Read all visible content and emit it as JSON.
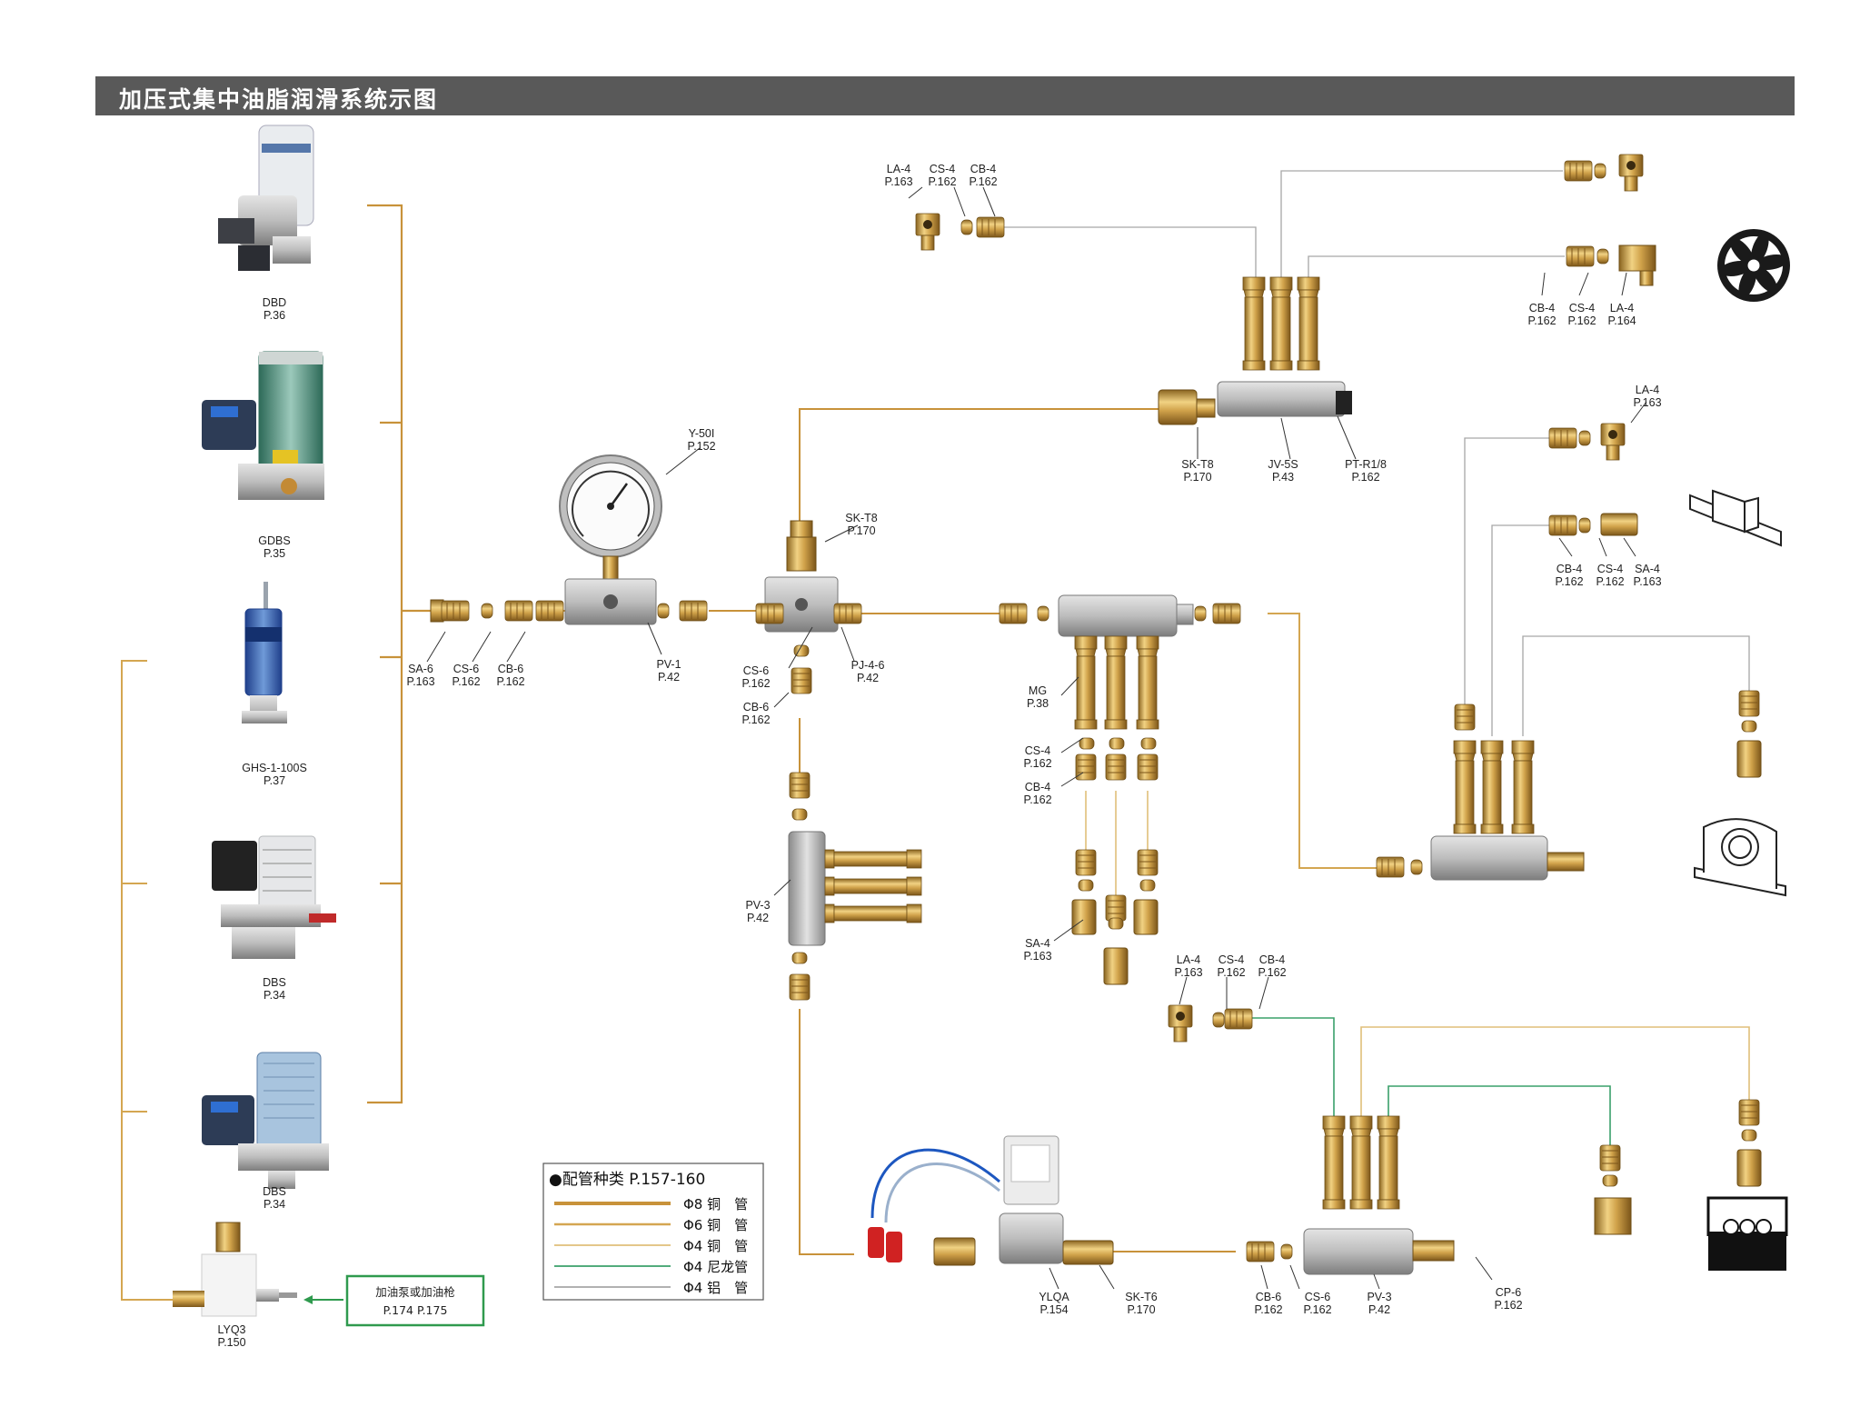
{
  "title": "加压式集中油脂润滑系统示图",
  "pumps": [
    {
      "model": "DBD",
      "page": "P.36"
    },
    {
      "model": "GDBS",
      "page": "P.35"
    },
    {
      "model": "GHS-1-100S",
      "page": "P.37"
    },
    {
      "model": "DBS",
      "page": "P.34"
    },
    {
      "model": "DBS",
      "page": "P.34"
    }
  ],
  "filler": {
    "model": "LYQ3",
    "page": "P.150"
  },
  "filler_notice": {
    "line1": "加油泵或加油枪",
    "line2": "P.174  P.175"
  },
  "gauge": {
    "model": "Y-50I",
    "page": "P.152"
  },
  "parts": {
    "sa6": {
      "model": "SA-6",
      "page": "P.163"
    },
    "cs6": {
      "model": "CS-6",
      "page": "P.162"
    },
    "cb6": {
      "model": "CB-6",
      "page": "P.162"
    },
    "pv1": {
      "model": "PV-1",
      "page": "P.42"
    },
    "skt8_mid": {
      "model": "SK-T8",
      "page": "P.170"
    },
    "pj46": {
      "model": "PJ-4-6",
      "page": "P.42"
    },
    "cs6_b": {
      "model": "CS-6",
      "page": "P.162"
    },
    "cb6_b": {
      "model": "CB-6",
      "page": "P.162"
    },
    "pv3_left": {
      "model": "PV-3",
      "page": "P.42"
    },
    "mg": {
      "model": "MG",
      "page": "P.38"
    },
    "cs4_mg": {
      "model": "CS-4",
      "page": "P.162"
    },
    "cb4_mg": {
      "model": "CB-4",
      "page": "P.162"
    },
    "sa4_mg": {
      "model": "SA-4",
      "page": "P.163"
    },
    "la4_top": {
      "model": "LA-4",
      "page": "P.163"
    },
    "cs4_top": {
      "model": "CS-4",
      "page": "P.162"
    },
    "cb4_top": {
      "model": "CB-4",
      "page": "P.162"
    },
    "skt8_top": {
      "model": "SK-T8",
      "page": "P.170"
    },
    "jv5s": {
      "model": "JV-5S",
      "page": "P.43"
    },
    "ptr18": {
      "model": "PT-R1/8",
      "page": "P.162"
    },
    "cb4_tr": {
      "model": "CB-4",
      "page": "P.162"
    },
    "cs4_tr": {
      "model": "CS-4",
      "page": "P.162"
    },
    "la4_tr": {
      "model": "LA-4",
      "page": "P.164"
    },
    "la4_r": {
      "model": "LA-4",
      "page": "P.163"
    },
    "cb4_r": {
      "model": "CB-4",
      "page": "P.162"
    },
    "cs4_r": {
      "model": "CS-4",
      "page": "P.162"
    },
    "sa4_r": {
      "model": "SA-4",
      "page": "P.163"
    },
    "la4_b": {
      "model": "LA-4",
      "page": "P.163"
    },
    "cs4_b": {
      "model": "CS-4",
      "page": "P.162"
    },
    "cb4_b": {
      "model": "CB-4",
      "page": "P.162"
    },
    "ylqa": {
      "model": "YLQA",
      "page": "P.154"
    },
    "skt6": {
      "model": "SK-T6",
      "page": "P.170"
    },
    "cb6_br": {
      "model": "CB-6",
      "page": "P.162"
    },
    "cs6_br": {
      "model": "CS-6",
      "page": "P.162"
    },
    "pv3_br": {
      "model": "PV-3",
      "page": "P.42"
    },
    "cp6": {
      "model": "CP-6",
      "page": "P.162"
    }
  },
  "legend": {
    "title": "●配管种类 P.157-160",
    "items": [
      {
        "label": "Φ8 铜　管",
        "color": "#c8a060",
        "weight": "thick"
      },
      {
        "label": "Φ6 铜　管",
        "color": "#d4a651",
        "weight": "medium"
      },
      {
        "label": "Φ4 铜　管",
        "color": "#e0bf7a",
        "weight": "thin"
      },
      {
        "label": "Φ4 尼龙管",
        "color": "#3aa06a",
        "weight": "thin"
      },
      {
        "label": "Φ4 铝　管",
        "color": "#a6a6a6",
        "weight": "thin"
      }
    ]
  },
  "colors": {
    "copper8": "#c8923a",
    "copper6": "#d4a651",
    "copper4": "#e0bf7a",
    "nylon": "#3aa06a",
    "aluminum": "#a6a6a6",
    "brass": "#c9a14a",
    "title_bar": "#595959"
  },
  "icons": [
    "fan-icon",
    "linear-guide-icon",
    "bearing-block-icon",
    "slide-way-icon"
  ]
}
